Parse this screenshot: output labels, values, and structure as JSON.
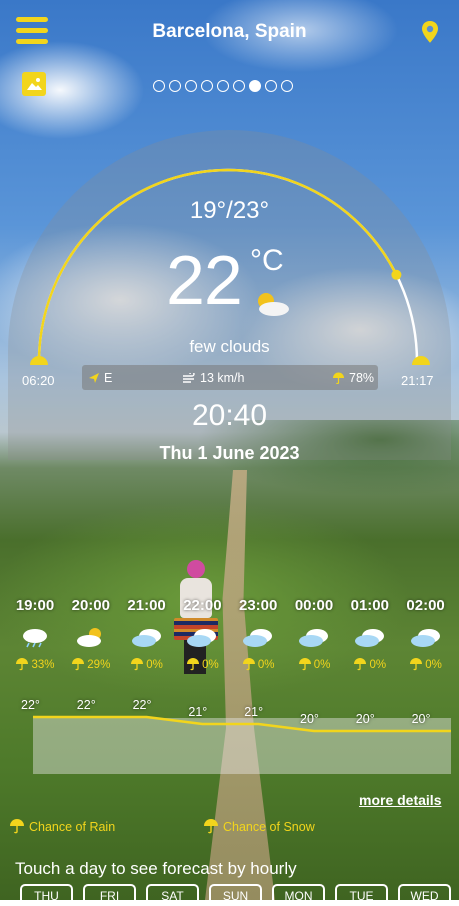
{
  "header": {
    "city": "Barcelona, Spain",
    "menu_icon": "hamburger-menu-icon",
    "location_icon": "location-pin-icon",
    "photo_icon": "photo-icon"
  },
  "pager": {
    "count": 9,
    "active_index": 6
  },
  "current": {
    "min_max": "19°/23°",
    "temperature": "22",
    "unit": "°C",
    "condition": "few clouds",
    "sunrise": "06:20",
    "sunset": "21:17",
    "wind_direction": "E",
    "wind_speed": "13 km/h",
    "humidity": "78%",
    "time": "20:40",
    "date": "Thu 1 June 2023",
    "sun_progress": 0.85
  },
  "hourly": [
    {
      "time": "19:00",
      "icon": "rain-cloud-icon",
      "rain": "33%",
      "temp": "22°"
    },
    {
      "time": "20:00",
      "icon": "sun-cloud-icon",
      "rain": "29%",
      "temp": "22°"
    },
    {
      "time": "21:00",
      "icon": "cloud-icon",
      "rain": "0%",
      "temp": "22°"
    },
    {
      "time": "22:00",
      "icon": "cloud-icon",
      "rain": "0%",
      "temp": "21°"
    },
    {
      "time": "23:00",
      "icon": "cloud-icon",
      "rain": "0%",
      "temp": "21°"
    },
    {
      "time": "00:00",
      "icon": "cloud-icon",
      "rain": "0%",
      "temp": "20°"
    },
    {
      "time": "01:00",
      "icon": "cloud-icon",
      "rain": "0%",
      "temp": "20°"
    },
    {
      "time": "02:00",
      "icon": "cloud-icon",
      "rain": "0%",
      "temp": "20°"
    }
  ],
  "more_details": "more details",
  "legend": {
    "rain": "Chance of Rain",
    "snow": "Chance of Snow"
  },
  "touch_hint": "Touch a day to see forecast by hourly",
  "days": [
    "THU",
    "FRI",
    "SAT",
    "SUN",
    "MON",
    "TUE",
    "WED"
  ],
  "colors": {
    "accent": "#f2d51c"
  }
}
